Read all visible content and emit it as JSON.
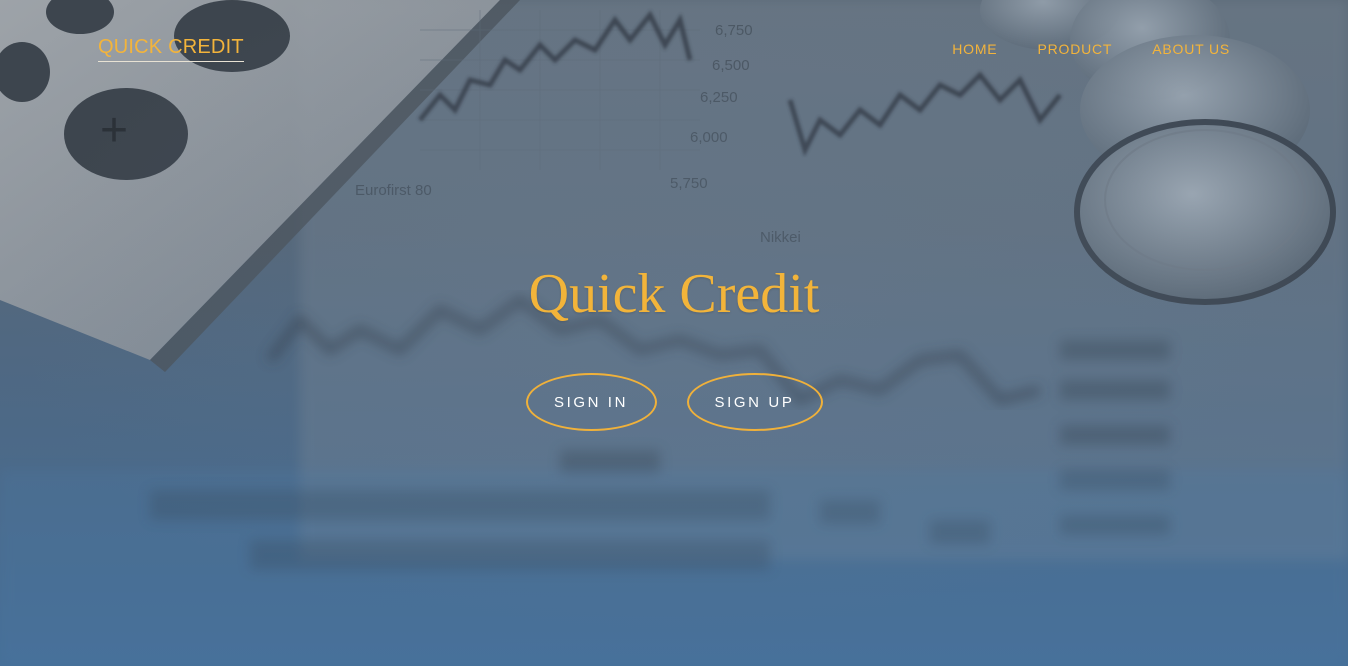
{
  "navbar": {
    "brand": "QUICK CREDIT",
    "links": [
      "HOME",
      "PRODUCT",
      "ABOUT US"
    ]
  },
  "hero": {
    "title": "Quick Credit",
    "buttons": {
      "sign_in": "SIGN IN",
      "sign_up": "SIGN UP"
    }
  },
  "colors": {
    "accent": "#f3b43b",
    "button_text": "#ffffff",
    "background_top": "#5c6a78",
    "background_bottom": "#466f98"
  }
}
